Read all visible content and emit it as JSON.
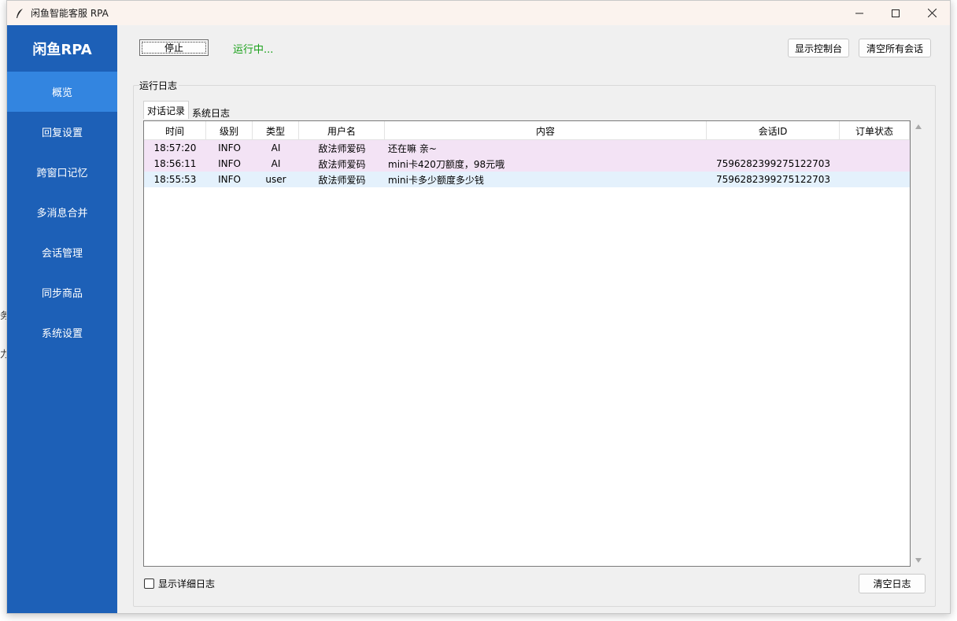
{
  "window": {
    "title": "闲鱼智能客服 RPA"
  },
  "desktop_fragments": [
    "务",
    "力"
  ],
  "sidebar": {
    "brand": "闲鱼RPA",
    "items": [
      {
        "label": "概览",
        "active": true
      },
      {
        "label": "回复设置",
        "active": false
      },
      {
        "label": "跨窗口记忆",
        "active": false
      },
      {
        "label": "多消息合并",
        "active": false
      },
      {
        "label": "会话管理",
        "active": false
      },
      {
        "label": "同步商品",
        "active": false
      },
      {
        "label": "系统设置",
        "active": false
      }
    ]
  },
  "toolbar": {
    "stop_label": "停止",
    "status_text": "运行中...",
    "status_color": "#18a018",
    "console_label": "显示控制台",
    "clear_sessions_label": "清空所有会话"
  },
  "log": {
    "group_label": "运行日志",
    "tabs": [
      {
        "label": "对话记录",
        "active": true
      },
      {
        "label": "系统日志",
        "active": false
      }
    ],
    "columns": [
      "时间",
      "级别",
      "类型",
      "用户名",
      "内容",
      "会话ID",
      "订单状态"
    ],
    "rows": [
      {
        "time": "18:57:20",
        "level": "INFO",
        "type": "AI",
        "user": "敌法师爱码",
        "content": "还在嘛 亲~",
        "session_id": "",
        "order_status": "",
        "kind": "ai"
      },
      {
        "time": "18:56:11",
        "level": "INFO",
        "type": "AI",
        "user": "敌法师爱码",
        "content": "mini卡420刀额度，98元哦",
        "session_id": "7596282399275122703",
        "order_status": "",
        "kind": "ai"
      },
      {
        "time": "18:55:53",
        "level": "INFO",
        "type": "user",
        "user": "敌法师爱码",
        "content": "mini卡多少额度多少钱",
        "session_id": "7596282399275122703",
        "order_status": "",
        "kind": "user"
      }
    ],
    "row_colors": {
      "ai": "#f3e3f5",
      "user": "#e4f1fc"
    },
    "show_detail_label": "显示详细日志",
    "show_detail_checked": false,
    "clear_log_label": "清空日志"
  },
  "colors": {
    "sidebar_bg": "#1d60b7",
    "sidebar_active": "#3385e0",
    "titlebar_bg": "#fbf3ee"
  }
}
